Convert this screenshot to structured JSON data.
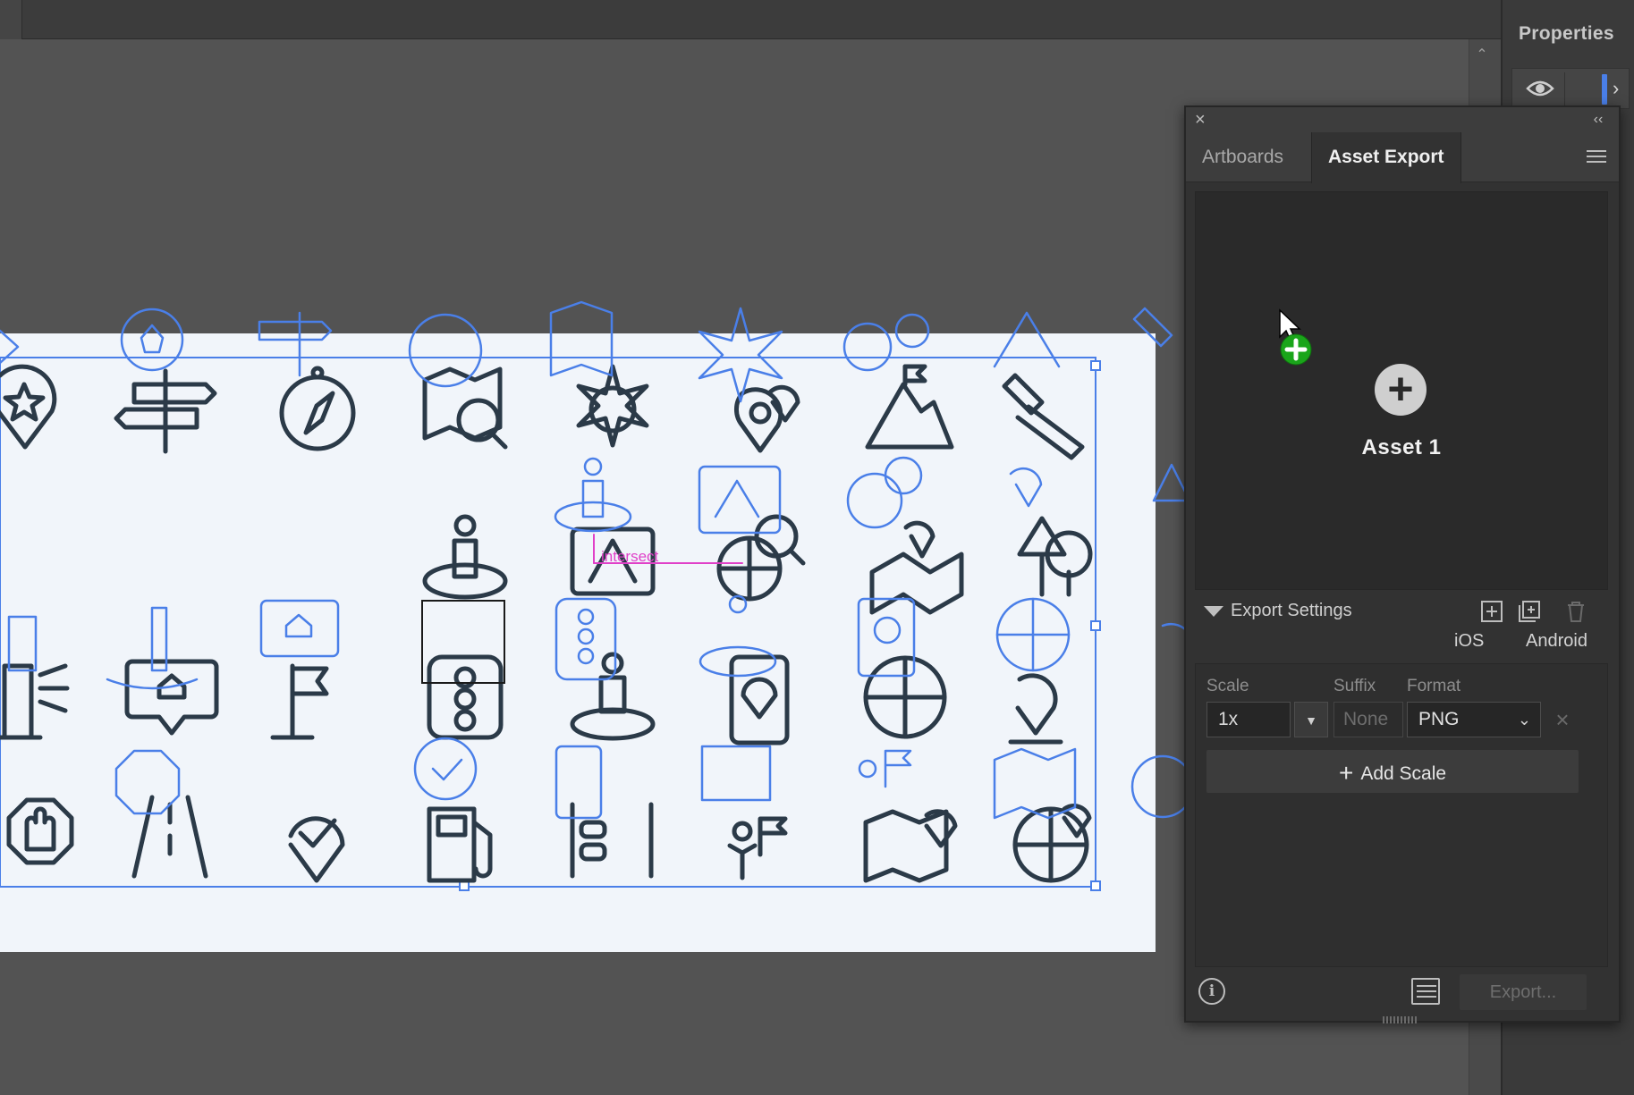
{
  "dock": {
    "title": "Properties"
  },
  "panel": {
    "tabs": [
      "Artboards",
      "Asset Export"
    ],
    "asset": {
      "label": "Asset 1"
    },
    "settings": {
      "label": "Export Settings",
      "platforms": [
        "iOS",
        "Android"
      ],
      "columns": {
        "scale": "Scale",
        "suffix": "Suffix",
        "format": "Format"
      },
      "scale_value": "1x",
      "suffix_placeholder": "None",
      "format_value": "PNG",
      "add_scale": "Add Scale"
    },
    "footer": {
      "export_label": "Export..."
    }
  },
  "canvas": {
    "smart_guide_label": "intersect"
  },
  "colors": {
    "icon_stroke": "#2b3a48",
    "selection_blue": "#4a7fe8",
    "artboard": "#f1f5fa",
    "guide_magenta": "#e040c8",
    "cursor_badge_green": "#1aa51a"
  }
}
